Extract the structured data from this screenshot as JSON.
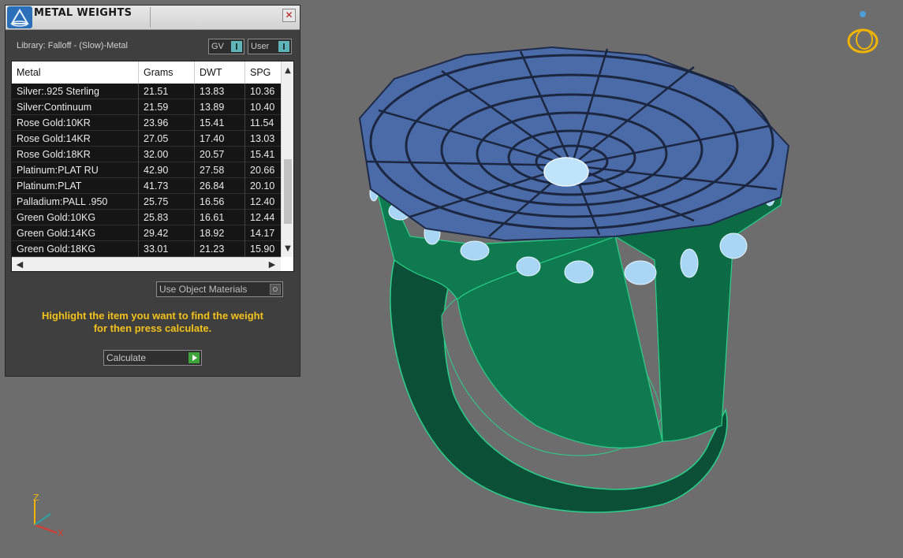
{
  "panel": {
    "title": "METAL WEIGHTS",
    "close_glyph": "✕",
    "library_label": "Library: Falloff - (Slow)-Metal",
    "toggles": {
      "gv_label": "GV",
      "user_label": "User"
    },
    "table": {
      "columns": [
        "Metal",
        "Grams",
        "DWT",
        "SPG"
      ],
      "rows": [
        [
          "Silver:.925 Sterling",
          "21.51",
          "13.83",
          "10.36"
        ],
        [
          "Silver:Continuum",
          "21.59",
          "13.89",
          "10.40"
        ],
        [
          "Rose Gold:10KR",
          "23.96",
          "15.41",
          "11.54"
        ],
        [
          "Rose Gold:14KR",
          "27.05",
          "17.40",
          "13.03"
        ],
        [
          "Rose Gold:18KR",
          "32.00",
          "20.57",
          "15.41"
        ],
        [
          "Platinum:PLAT RU",
          "42.90",
          "27.58",
          "20.66"
        ],
        [
          "Platinum:PLAT",
          "41.73",
          "26.84",
          "20.10"
        ],
        [
          "Palladium:PALL .950",
          "25.75",
          "16.56",
          "12.40"
        ],
        [
          "Green Gold:10KG",
          "25.83",
          "16.61",
          "12.44"
        ],
        [
          "Green Gold:14KG",
          "29.42",
          "18.92",
          "14.17"
        ],
        [
          "Green Gold:18KG",
          "33.01",
          "21.23",
          "15.90"
        ]
      ]
    },
    "use_object_materials_label": "Use Object Materials",
    "hint_line1": "Highlight the item you want to find the weight",
    "hint_line2": "for then press calculate.",
    "calculate_label": "Calculate"
  },
  "viewport": {
    "axis": {
      "z": "Z",
      "x": "X"
    },
    "colors": {
      "background": "#6d6d6d",
      "ring_shank": "#0e6e4a",
      "ring_top": "#4f6faf",
      "gem": "#a9d6f5",
      "axis_icon": "#f0b400"
    }
  },
  "icons": [
    "app-logo-icon",
    "close-icon",
    "ring-nav-icon",
    "axis-gizmo-icon",
    "play-icon"
  ]
}
